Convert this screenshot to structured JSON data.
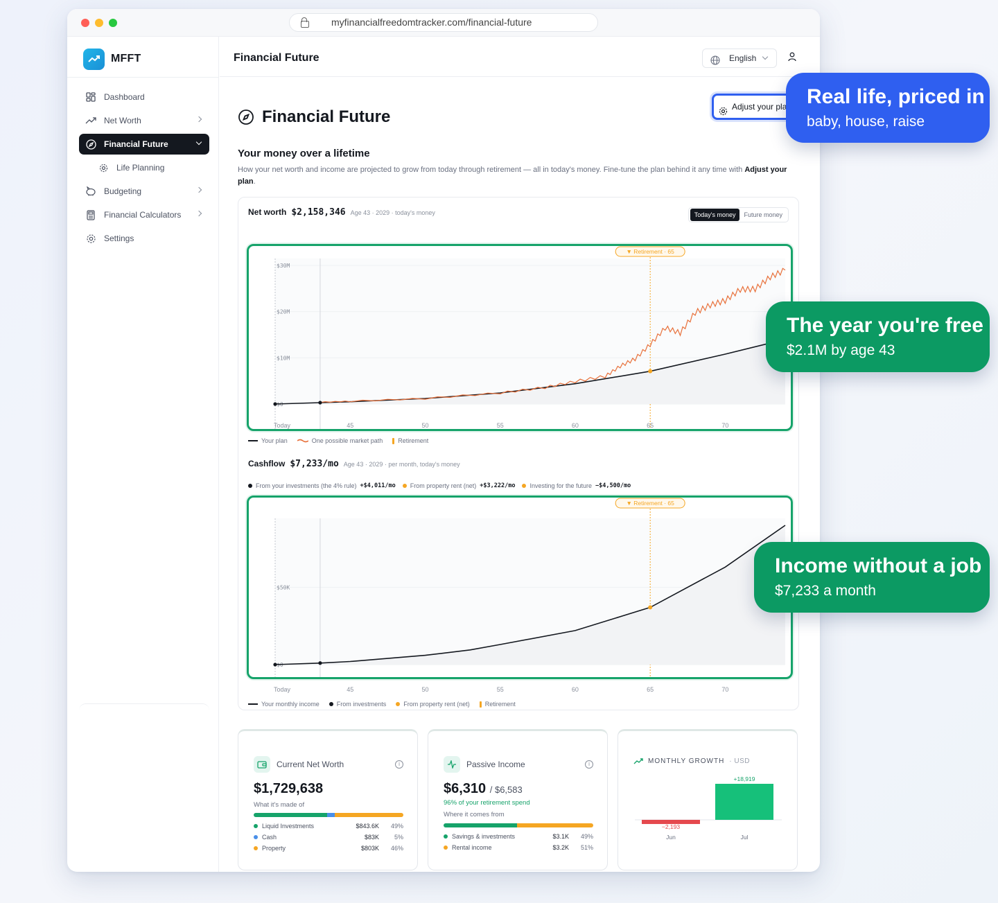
{
  "browser": {
    "url": "myfinancialfreedomtracker.com/financial-future"
  },
  "brand": {
    "name": "MFFT"
  },
  "sidebar": {
    "items": [
      {
        "label": "Dashboard",
        "icon": "grid-icon"
      },
      {
        "label": "Net Worth",
        "icon": "trending-up-icon"
      },
      {
        "label": "Financial Future",
        "icon": "compass-icon",
        "active": true
      },
      {
        "label": "Life Planning",
        "icon": "gear-icon",
        "sub": true
      },
      {
        "label": "Budgeting",
        "icon": "piggy-bank-icon"
      },
      {
        "label": "Financial Calculators",
        "icon": "calculator-icon"
      },
      {
        "label": "Settings",
        "icon": "settings-icon"
      }
    ]
  },
  "topbar": {
    "title": "Financial Future",
    "language": "English"
  },
  "page": {
    "title": "Financial Future",
    "adjust_button": "Adjust your plan",
    "section_title": "Your money over a lifetime",
    "section_desc": "How your net worth and income are projected to grow from today through retirement — all in today's money. Fine-tune the plan behind it any time with ",
    "section_desc_link": "Adjust your plan",
    "section_desc_end": "."
  },
  "net_worth_card": {
    "label": "Net worth",
    "value": "$2,158,346",
    "meta": "Age 43 · 2029 · today's money",
    "toggle": [
      "Today's money",
      "Future money"
    ],
    "legend": [
      "Your plan",
      "One possible market path",
      "Retirement"
    ]
  },
  "cashflow_card": {
    "label": "Cashflow",
    "value": "$7,233/mo",
    "meta": "Age 43 · 2029 · per month, today's money",
    "parts": [
      {
        "label": "From your investments (the 4% rule)",
        "value": "+$4,011/mo",
        "color": "#14181f"
      },
      {
        "label": "From property rent (net)",
        "value": "+$3,222/mo",
        "color": "#f5a623"
      },
      {
        "label": "Investing for the future",
        "value": "−$4,500/mo",
        "color": "#f5a623"
      }
    ],
    "legend": [
      "Your monthly income",
      "From investments",
      "From property rent (net)",
      "Retirement"
    ]
  },
  "chart_data": [
    {
      "type": "line",
      "title": "Net worth",
      "x_ticks": [
        "Today",
        "45",
        "50",
        "55",
        "60",
        "65",
        "70"
      ],
      "y_ticks": [
        "$30M",
        "$20M",
        "$10M",
        "$0"
      ],
      "ylim": [
        0,
        30
      ],
      "xlim": [
        40,
        74
      ],
      "retirement_label": "▼ Retirement · 65",
      "retirement_age": 65,
      "series": [
        {
          "name": "Your plan",
          "x": [
            40,
            43,
            45,
            50,
            55,
            60,
            65,
            70,
            74
          ],
          "values": [
            0.0,
            0.3,
            0.5,
            1.2,
            2.4,
            4.4,
            7.1,
            10.8,
            14.0
          ]
        },
        {
          "name": "One possible market path",
          "x": [
            43,
            45,
            50,
            55,
            58,
            60,
            62,
            63,
            64,
            65,
            66,
            67,
            68,
            69,
            70,
            71,
            72,
            73,
            74
          ],
          "values": [
            0.4,
            0.6,
            1.2,
            2.4,
            3.6,
            4.9,
            6.0,
            8.2,
            9.8,
            12.9,
            16.5,
            15.4,
            19.8,
            21.4,
            22.4,
            24.8,
            24.9,
            27.5,
            29.0
          ]
        }
      ]
    },
    {
      "type": "area",
      "title": "Cashflow",
      "x_ticks": [
        "Today",
        "45",
        "50",
        "55",
        "60",
        "65",
        "70"
      ],
      "y_ticks": [
        "$50K",
        "$0"
      ],
      "ylim": [
        0,
        90
      ],
      "xlim": [
        40,
        74
      ],
      "retirement_label": "▼ Retirement · 65",
      "retirement_age": 65,
      "series": [
        {
          "name": "Your monthly income",
          "x": [
            40,
            43,
            45,
            50,
            53,
            55,
            60,
            65,
            70,
            74
          ],
          "values": [
            0.0,
            1.0,
            2.0,
            6.0,
            9.5,
            13.0,
            22.0,
            37.0,
            63.0,
            90.0
          ]
        }
      ]
    },
    {
      "type": "bar",
      "title": "MONTHLY GROWTH",
      "categories": [
        "Jun",
        "Jul"
      ],
      "values": [
        -2193,
        18919
      ],
      "labels": [
        "−2,193",
        "+18,919"
      ]
    }
  ],
  "stats": {
    "net_worth": {
      "title": "Current Net Worth",
      "value": "$1,729,638",
      "sub": "What it's made of",
      "rows": [
        {
          "label": "Liquid Investments",
          "value": "$843.6K",
          "pct": "49%",
          "color": "#16a36a"
        },
        {
          "label": "Cash",
          "value": "$83K",
          "pct": "5%",
          "color": "#4a8fe8"
        },
        {
          "label": "Property",
          "value": "$803K",
          "pct": "46%",
          "color": "#f5a623"
        }
      ]
    },
    "passive": {
      "title": "Passive Income",
      "value": "$6,310",
      "target": "/ $6,583",
      "green": "96% of your retirement spend",
      "sub": "Where it comes from",
      "rows": [
        {
          "label": "Savings & investments",
          "value": "$3.1K",
          "pct": "49%",
          "color": "#16a36a"
        },
        {
          "label": "Rental income",
          "value": "$3.2K",
          "pct": "51%",
          "color": "#f5a623"
        }
      ]
    },
    "growth": {
      "title": "MONTHLY GROWTH",
      "unit": "· USD"
    }
  },
  "callouts": [
    {
      "headline": "Real life, priced in",
      "sub": "baby, house, raise"
    },
    {
      "headline": "The year you're free",
      "sub": "$2.1M by age 43"
    },
    {
      "headline": "Income without a job",
      "sub": "$7,233 a month"
    }
  ],
  "colors": {
    "accent_blue": "#2f5ff0",
    "accent_green": "#0c9a63",
    "orange": "#f5a623",
    "red": "#e5484d",
    "bar_green": "#16c07a"
  }
}
